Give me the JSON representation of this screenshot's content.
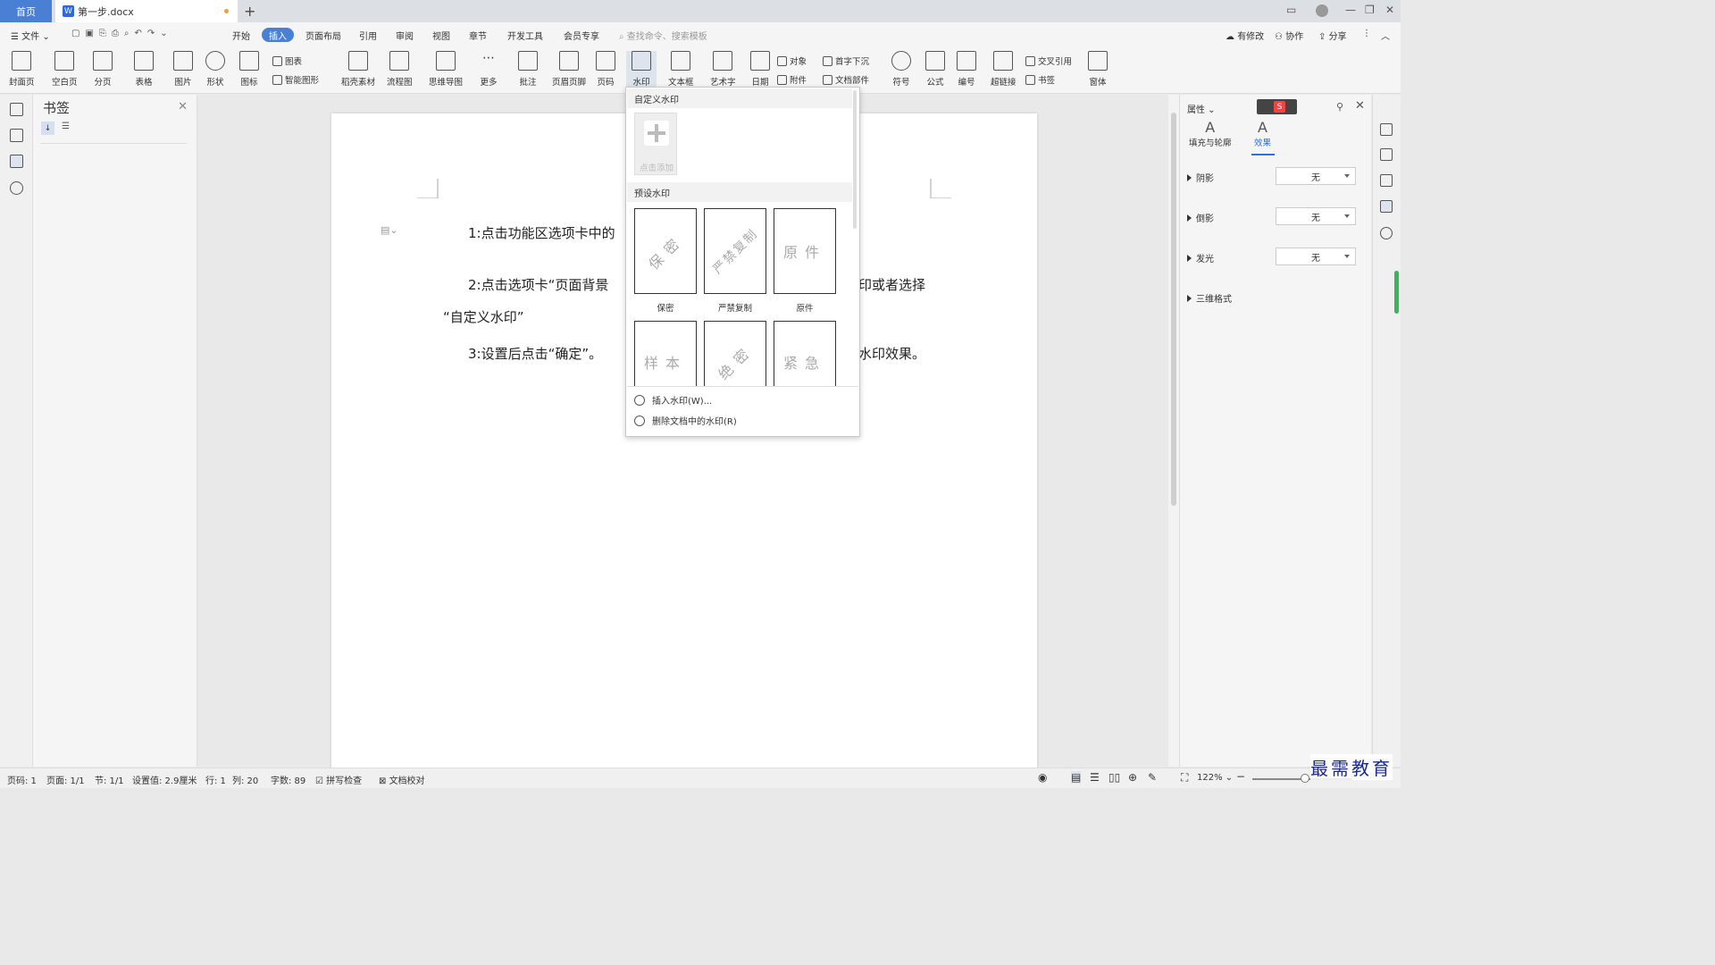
{
  "tabs": {
    "home": "首页",
    "doc": "第一步.docx"
  },
  "menu": {
    "file": "文件",
    "items": [
      "开始",
      "插入",
      "页面布局",
      "引用",
      "审阅",
      "视图",
      "章节",
      "开发工具",
      "会员专享"
    ],
    "search_placeholder": "查找命令、搜索模板",
    "right": [
      "有修改",
      "协作",
      "分享"
    ]
  },
  "toolbar": {
    "cover": "封面页",
    "blank": "空白页",
    "break": "分页",
    "table": "表格",
    "image": "图片",
    "shape": "形状",
    "icon": "图标",
    "chart": "图表",
    "smartart": "智能图形",
    "material": "稻壳素材",
    "flow": "流程图",
    "mind": "思维导图",
    "more": "更多",
    "comment": "批注",
    "header_footer": "页眉页脚",
    "page_num": "页码",
    "watermark": "水印",
    "textbox": "文本框",
    "wordart": "艺术字",
    "date": "日期",
    "object": "对象",
    "attach": "附件",
    "dropcap": "首字下沉",
    "docpart": "文档部件",
    "symbol": "符号",
    "formula": "公式",
    "numbering": "编号",
    "hyperlink": "超链接",
    "crossref": "交叉引用",
    "bookmark": "书签",
    "window": "窗体"
  },
  "bookmark_panel": {
    "title": "书签"
  },
  "document": {
    "lines": [
      "1:点击功能区选项卡中的",
      "2:点击选项卡“页面背景",
      "印或者选择",
      "“自定义水印”",
      "3:设置后点击“确定”。",
      "水印效果。"
    ]
  },
  "watermark_menu": {
    "custom_title": "自定义水印",
    "add_label": "点击添加",
    "preset_title": "预设水印",
    "presets": [
      {
        "text": "保密",
        "caption": "保密"
      },
      {
        "text": "严禁复制",
        "caption": "严禁复制"
      },
      {
        "text": "原件",
        "caption": "原件"
      },
      {
        "text": "样本",
        "caption": ""
      },
      {
        "text": "绝密",
        "caption": ""
      },
      {
        "text": "紧急",
        "caption": ""
      }
    ],
    "insert_action": "插入水印(W)...",
    "delete_action": "删除文档中的水印(R)"
  },
  "properties": {
    "title": "属性",
    "tab_fill": "填充与轮廓",
    "tab_effect": "效果",
    "rows": [
      {
        "label": "阴影",
        "value": "无"
      },
      {
        "label": "倒影",
        "value": "无"
      },
      {
        "label": "发光",
        "value": "无"
      },
      {
        "label": "三维格式",
        "value": ""
      }
    ]
  },
  "status": {
    "page_code": "页码: 1",
    "page": "页面: 1/1",
    "section": "节: 1/1",
    "setting": "设置值: 2.9厘米",
    "row": "行: 1",
    "col": "列: 20",
    "words": "字数: 89",
    "spell": "拼写检查",
    "proof": "文档校对",
    "zoom": "122%"
  },
  "brand": "最需教育",
  "colors": {
    "accent": "#4a7fd6",
    "effect_tab": "#2f6fd6",
    "scroll_green": "#3ab55a"
  }
}
